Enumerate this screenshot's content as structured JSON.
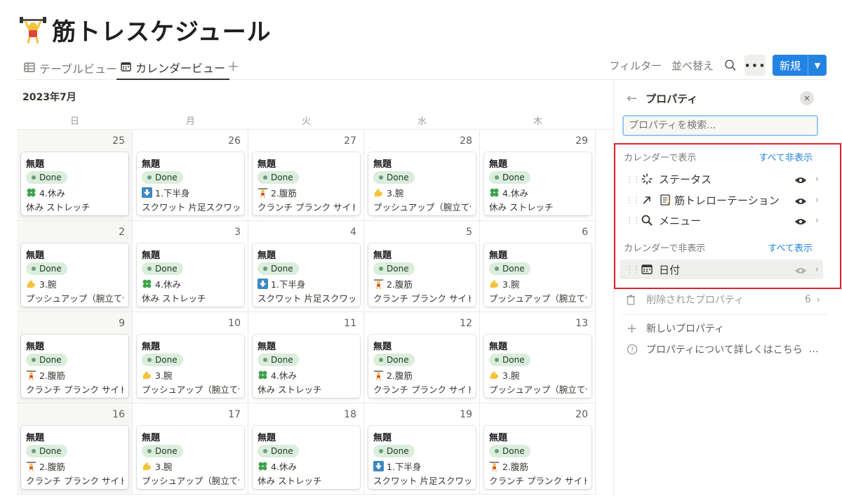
{
  "page": {
    "title": "筋トレスケジュール",
    "title_icon": "weightlifter-icon"
  },
  "tabs": [
    {
      "label": "テーブルビュー",
      "icon": "table-icon",
      "active": false
    },
    {
      "label": "カレンダービュー",
      "icon": "calendar-icon",
      "active": true
    }
  ],
  "toolbar": {
    "filter": "フィルター",
    "sort": "並べ替え",
    "more": "•••",
    "new": "新規"
  },
  "calendar": {
    "month": "2023年7月",
    "weekdays": [
      "日",
      "月",
      "火",
      "水",
      "木"
    ],
    "weeks": [
      {
        "days": [
          {
            "num": "25",
            "title": "無題",
            "status": "Done",
            "menu": "4.休み",
            "menu_icon": "clover-icon",
            "detail": "休み ストレッチ"
          },
          {
            "num": "26",
            "title": "無題",
            "status": "Done",
            "menu": "1.下半身",
            "menu_icon": "down-arrow-icon",
            "detail": "スクワット 片足スクワット"
          },
          {
            "num": "27",
            "title": "無題",
            "status": "Done",
            "menu": "2.腹筋",
            "menu_icon": "weightlifter-icon",
            "detail": "クランチ プランク サイドプランク"
          },
          {
            "num": "28",
            "title": "無題",
            "status": "Done",
            "menu": "3.腕",
            "menu_icon": "biceps-icon",
            "detail": "プッシュアップ（腕立て伏せ）"
          },
          {
            "num": "29",
            "title": "無題",
            "status": "Done",
            "menu": "4.休み",
            "menu_icon": "clover-icon",
            "detail": "休み ストレッチ"
          }
        ]
      },
      {
        "days": [
          {
            "num": "2",
            "title": "無題",
            "status": "Done",
            "menu": "3.腕",
            "menu_icon": "biceps-icon",
            "detail": "プッシュアップ（腕立て伏せ）"
          },
          {
            "num": "3",
            "title": "無題",
            "status": "Done",
            "menu": "4.休み",
            "menu_icon": "clover-icon",
            "detail": "休み ストレッチ"
          },
          {
            "num": "4",
            "title": "無題",
            "status": "Done",
            "menu": "1.下半身",
            "menu_icon": "down-arrow-icon",
            "detail": "スクワット 片足スクワット"
          },
          {
            "num": "5",
            "title": "無題",
            "status": "Done",
            "menu": "2.腹筋",
            "menu_icon": "weightlifter-icon",
            "detail": "クランチ プランク サイドプランク"
          },
          {
            "num": "6",
            "title": "無題",
            "status": "Done",
            "menu": "3.腕",
            "menu_icon": "biceps-icon",
            "detail": "プッシュアップ（腕立て伏せ）"
          }
        ]
      },
      {
        "days": [
          {
            "num": "9",
            "title": "無題",
            "status": "Done",
            "menu": "2.腹筋",
            "menu_icon": "weightlifter-icon",
            "detail": "クランチ プランク サイドプランク"
          },
          {
            "num": "10",
            "title": "無題",
            "status": "Done",
            "menu": "3.腕",
            "menu_icon": "biceps-icon",
            "detail": "プッシュアップ（腕立て伏せ）"
          },
          {
            "num": "11",
            "title": "無題",
            "status": "Done",
            "menu": "4.休み",
            "menu_icon": "clover-icon",
            "detail": "休み ストレッチ"
          },
          {
            "num": "12",
            "title": "無題",
            "status": "Done",
            "menu": "2.腹筋",
            "menu_icon": "weightlifter-icon",
            "detail": "クランチ プランク サイドプランク"
          },
          {
            "num": "13",
            "title": "無題",
            "status": "Done",
            "menu": "3.腕",
            "menu_icon": "biceps-icon",
            "detail": "プッシュアップ（腕立て伏せ）"
          }
        ]
      },
      {
        "days": [
          {
            "num": "16",
            "title": "無題",
            "status": "Done",
            "menu": "2.腹筋",
            "menu_icon": "weightlifter-icon",
            "detail": "クランチ プランク サイドプランク"
          },
          {
            "num": "17",
            "title": "無題",
            "status": "Done",
            "menu": "3.腕",
            "menu_icon": "biceps-icon",
            "detail": "プッシュアップ（腕立て伏せ）"
          },
          {
            "num": "18",
            "title": "無題",
            "status": "Done",
            "menu": "4.休み",
            "menu_icon": "clover-icon",
            "detail": "休み ストレッチ"
          },
          {
            "num": "19",
            "title": "無題",
            "status": "Done",
            "menu": "1.下半身",
            "menu_icon": "down-arrow-icon",
            "detail": "スクワット 片足スクワット"
          },
          {
            "num": "20",
            "title": "無題",
            "status": "Done",
            "menu": "2.腹筋",
            "menu_icon": "weightlifter-icon",
            "detail": "クランチ プランク サイドプランク"
          }
        ]
      }
    ]
  },
  "panel": {
    "title": "プロパティ",
    "search_placeholder": "プロパティを検索...",
    "shown_label": "カレンダーで表示",
    "hide_all": "すべて非表示",
    "shown": [
      {
        "name": "ステータス",
        "icon": "status-icon"
      },
      {
        "name": "筋トレローテーション",
        "icon": "relation-icon"
      },
      {
        "name": "メニュー",
        "icon": "search-icon"
      }
    ],
    "hidden_label": "カレンダーで非表示",
    "show_all": "すべて表示",
    "hidden": [
      {
        "name": "日付",
        "icon": "calendar-icon"
      }
    ],
    "deleted_label": "削除されたプロパティ",
    "deleted_count": "6",
    "new_property": "新しいプロパティ",
    "learn_more": "プロパティについて詳しくはこちら"
  },
  "colors": {
    "accent": "#2383e2",
    "done_bg": "#dbeddb",
    "highlight": "#e0222b"
  }
}
